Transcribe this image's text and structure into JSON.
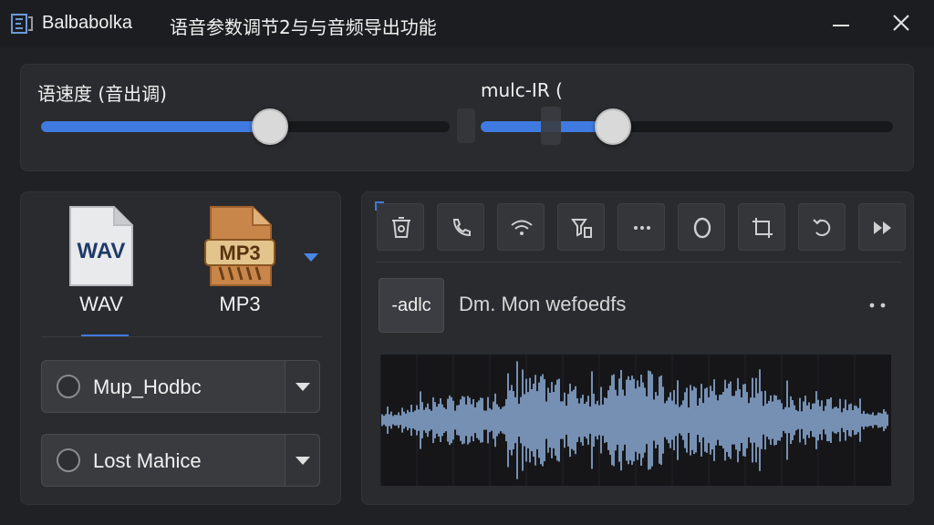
{
  "titlebar": {
    "app_name": "Balbabolka",
    "window_title": "语音参数调节2与与音频导出功能",
    "app_icon": "balabolka-logo-icon",
    "minimize_icon": "minimize-icon",
    "close_icon": "close-icon"
  },
  "sliders": {
    "rate_label": "语速度 (音出调)",
    "rate_value": 0.56,
    "pitch_label": "mulc-IR (",
    "pitch_value": 0.32
  },
  "formats": {
    "wav_badge": "WAV",
    "wav_caption": "WAV",
    "mp3_badge": "MP3",
    "mp3_caption": "MP3",
    "selected": "WAV",
    "options": [
      {
        "label": "Mup_Hodbc"
      },
      {
        "label": "Lost Mahice"
      }
    ]
  },
  "toolbar": {
    "icons": [
      "trash-icon",
      "phone-icon",
      "wifi-icon",
      "filter-icon",
      "more-horizontal-icon",
      "record-icon",
      "crop-icon",
      "undo-icon",
      "fast-forward-icon"
    ]
  },
  "audio": {
    "button_label": "-adlc",
    "track_label": "Dm. Mon wefoedfs",
    "menu_icon": "more-dots-icon"
  },
  "colors": {
    "accent": "#3f7ae0",
    "waveform": "#8fb0dc",
    "background": "#202124",
    "panel": "#2a2b2e"
  }
}
